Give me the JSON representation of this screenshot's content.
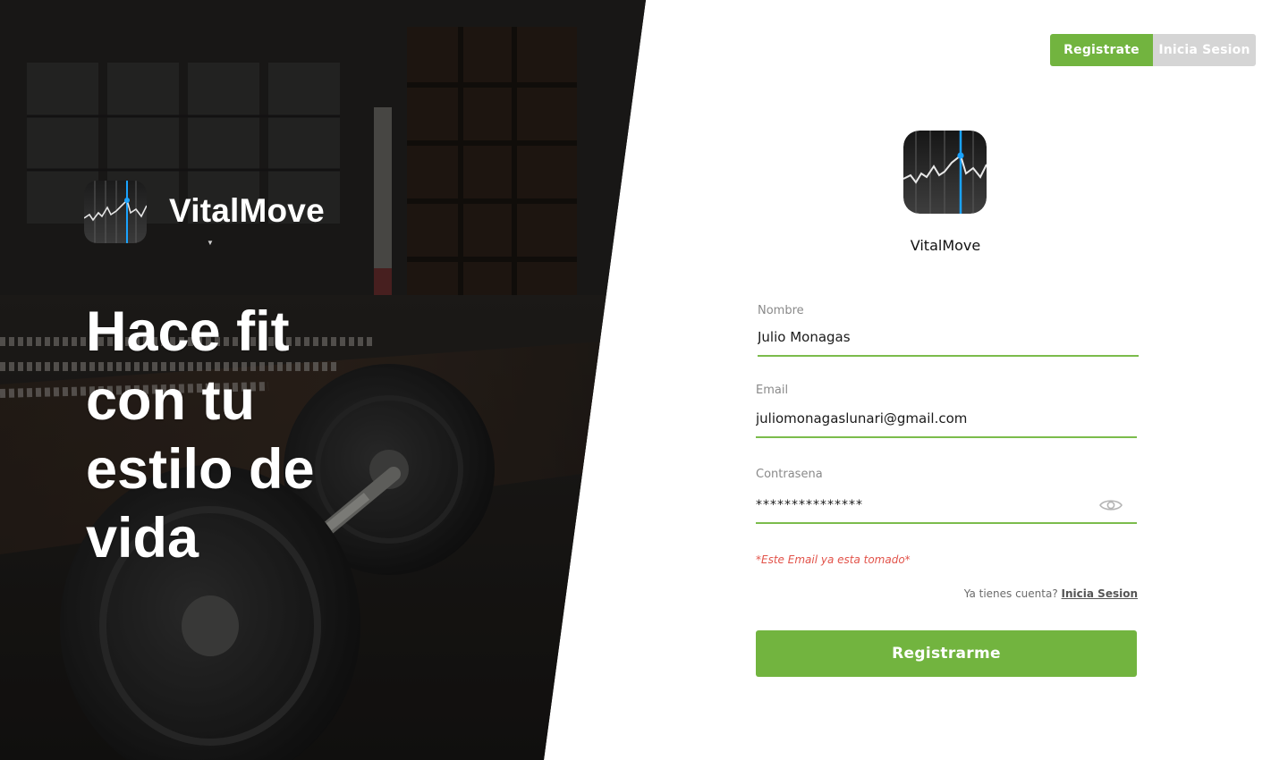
{
  "brand": {
    "name": "VitalMove"
  },
  "hero": {
    "title": "Hace fit con tu estilo de vida"
  },
  "auth_toggle": {
    "register_label": "Registrate",
    "login_label": "Inicia Sesion",
    "active": "Registrate"
  },
  "form": {
    "nombre": {
      "label": "Nombre",
      "value": "Julio Monagas"
    },
    "email": {
      "label": "Email",
      "value": "juliomonagaslunari@gmail.com"
    },
    "password": {
      "label": "Contrasena",
      "value": "***************"
    },
    "error_message": "*Este Email ya esta tomado*",
    "login_prompt": "Ya tienes cuenta?",
    "login_link": "Inicia Sesion",
    "submit_label": "Registrarme"
  },
  "colors": {
    "accent": "#72b43f",
    "inactive_tab": "#d5d5d5",
    "error": "#e2534a",
    "highlight_blue": "#1aa3ff"
  },
  "icons": {
    "app_logo": "stock-chart-icon",
    "password_toggle": "eye-icon"
  }
}
